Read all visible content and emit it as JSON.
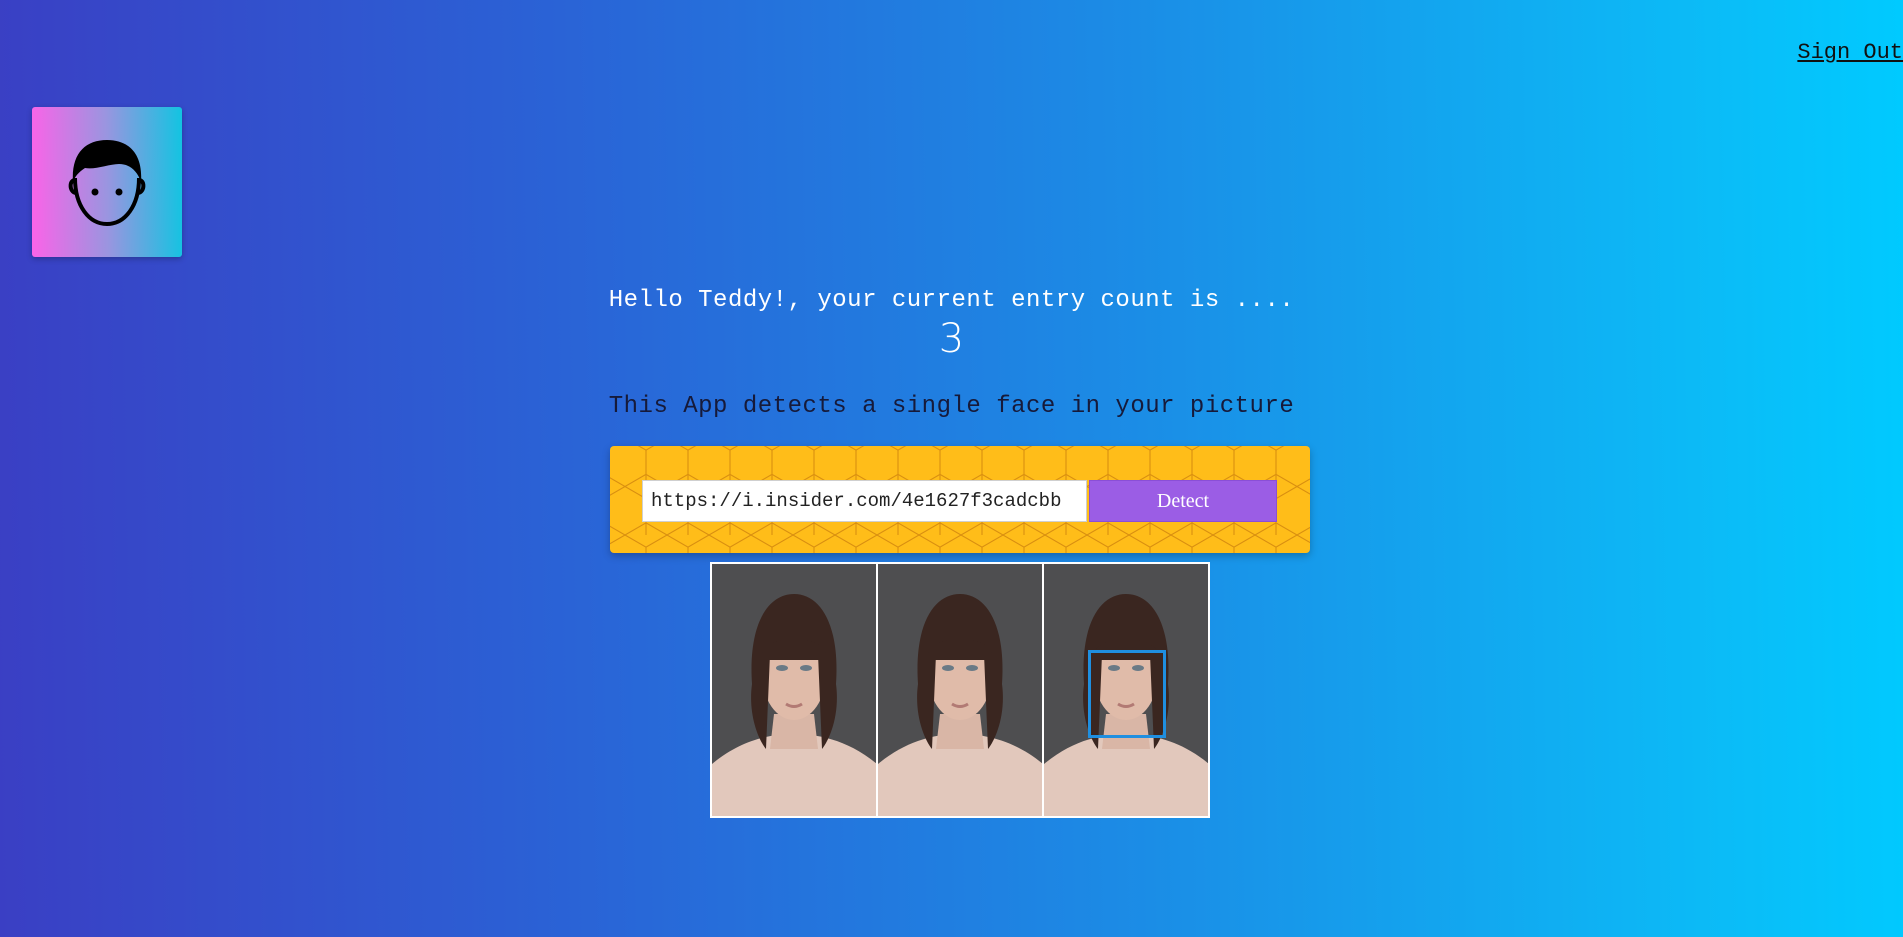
{
  "header": {
    "signout_label": "Sign Out"
  },
  "logo": {
    "icon": "face-icon"
  },
  "main": {
    "greeting": "Hello Teddy!, your current entry count is ....",
    "entry_count": "3",
    "tagline": "This App detects a single face in your picture"
  },
  "form": {
    "url_value": "https://i.insider.com/4e1627f3cadcbb",
    "detect_label": "Detect"
  },
  "result": {
    "image_alt": "detected face image",
    "face_box_detected": true
  },
  "colors": {
    "background_left": "#3a3fc4",
    "background_right": "#00caff",
    "panel": "#ffbd19",
    "button": "#9b5de5",
    "face_box": "#1f8fe0"
  }
}
